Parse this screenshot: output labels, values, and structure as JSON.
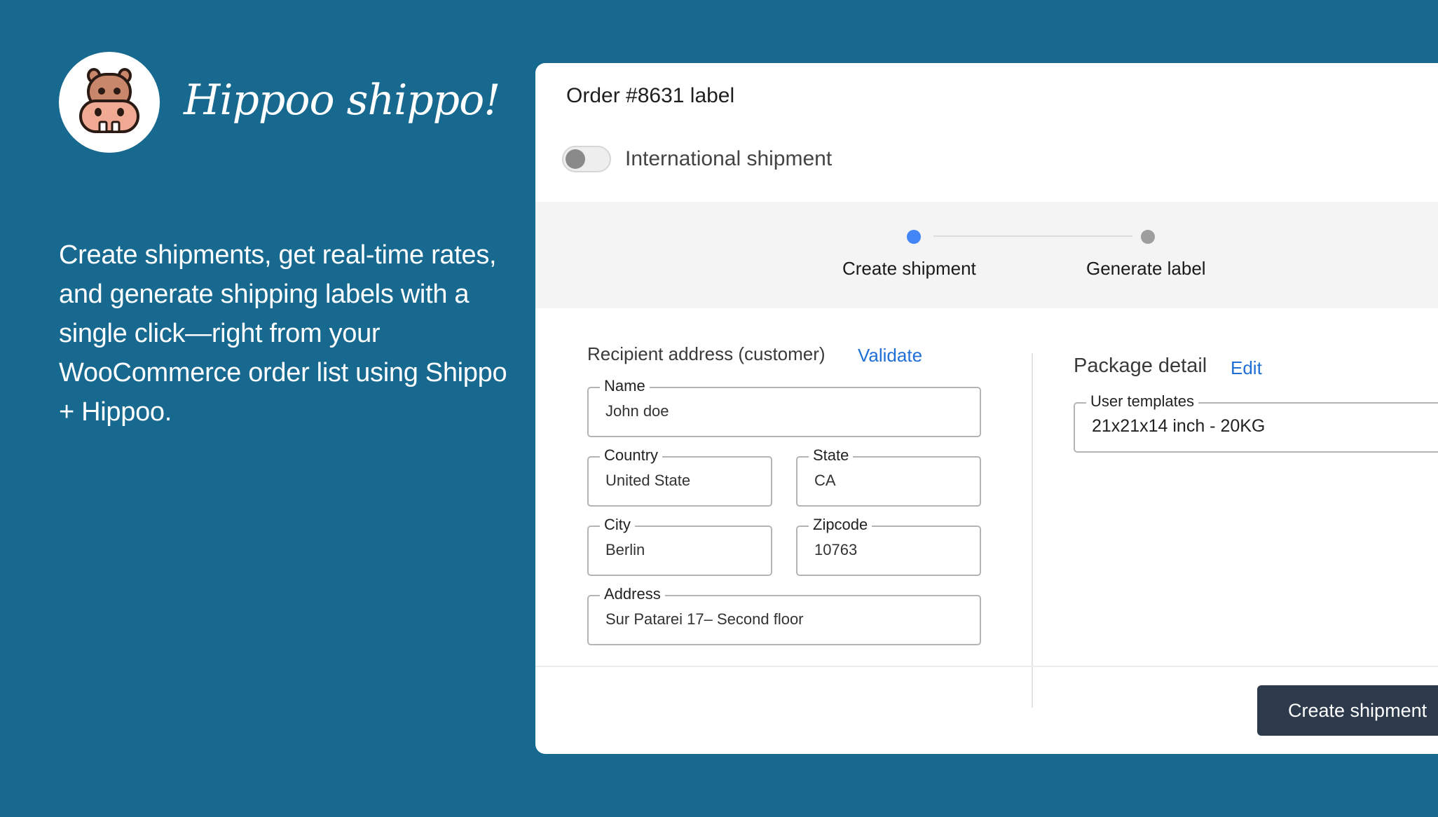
{
  "brand": {
    "name": "Hippoo shippo!",
    "tagline": "Create shipments, get real-time rates, and generate shipping labels with a single click—right from your WooCommerce order list using Shippo + Hippoo.",
    "logo_icon": "hippo-icon"
  },
  "dialog": {
    "title": "Order #8631 label",
    "international_toggle": {
      "label": "International shipment",
      "on": false
    },
    "stepper": {
      "steps": [
        {
          "label": "Create shipment",
          "state": "active"
        },
        {
          "label": "Generate label",
          "state": "pending"
        }
      ]
    },
    "recipient": {
      "title": "Recipient address (customer)",
      "validate_link": "Validate",
      "fields": {
        "name": {
          "label": "Name",
          "value": "John doe"
        },
        "country": {
          "label": "Country",
          "value": "United State"
        },
        "state": {
          "label": "State",
          "value": "CA"
        },
        "city": {
          "label": "City",
          "value": "Berlin"
        },
        "zipcode": {
          "label": "Zipcode",
          "value": "10763"
        },
        "address": {
          "label": "Address",
          "value": "Sur Patarei 17– Second floor"
        }
      }
    },
    "package": {
      "title": "Package detail",
      "edit_link": "Edit",
      "template_select": {
        "label": "User templates",
        "value": "21x21x14 inch - 20KG"
      }
    },
    "submit_button": "Create shipment"
  },
  "colors": {
    "background": "#17698f",
    "primary_button": "#2d3a4b",
    "link": "#1f6fd6",
    "active_step": "#4285f4",
    "pending_step": "#9e9e9e"
  }
}
